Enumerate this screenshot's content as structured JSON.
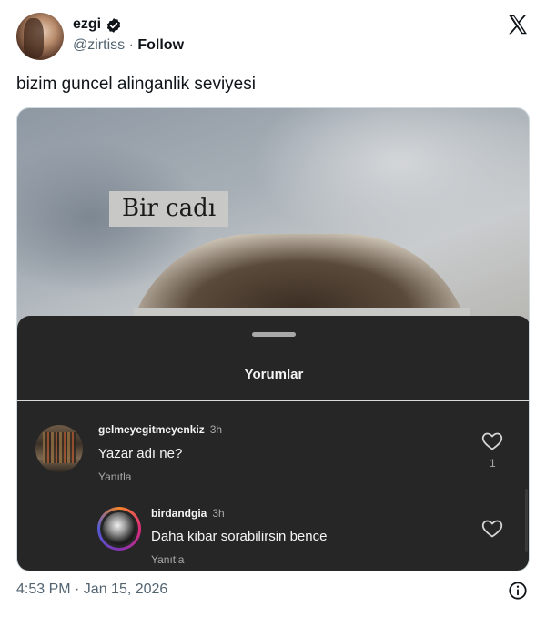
{
  "author": {
    "name": "ezgi",
    "handle": "@zirtiss",
    "separator": "·",
    "follow_label": "Follow"
  },
  "tweet": {
    "text": "bizim guncel alinganlik seviyesi"
  },
  "image": {
    "caption_text": "Bir cadı",
    "comments_sheet": {
      "title": "Yorumlar",
      "comments": [
        {
          "username": "gelmeyegitmeyenkiz",
          "time": "3h",
          "text": "Yazar adı ne?",
          "reply_label": "Yanıtla",
          "likes": "1"
        },
        {
          "username": "birdandgia",
          "time": "3h",
          "text": "Daha kibar sorabilirsin bence",
          "reply_label": "Yanıtla",
          "likes": ""
        }
      ]
    }
  },
  "footer": {
    "timestamp": "4:53 PM · Jan 15, 2026"
  },
  "icons": {
    "verified": "verified-badge-icon",
    "platform": "x-logo-icon",
    "like": "heart-icon",
    "info": "info-icon"
  },
  "colors": {
    "text_primary": "#0f1419",
    "text_secondary": "#536471",
    "sheet_bg": "#262626",
    "sheet_text": "#f5f5f5",
    "sheet_muted": "#a8a8a8"
  }
}
